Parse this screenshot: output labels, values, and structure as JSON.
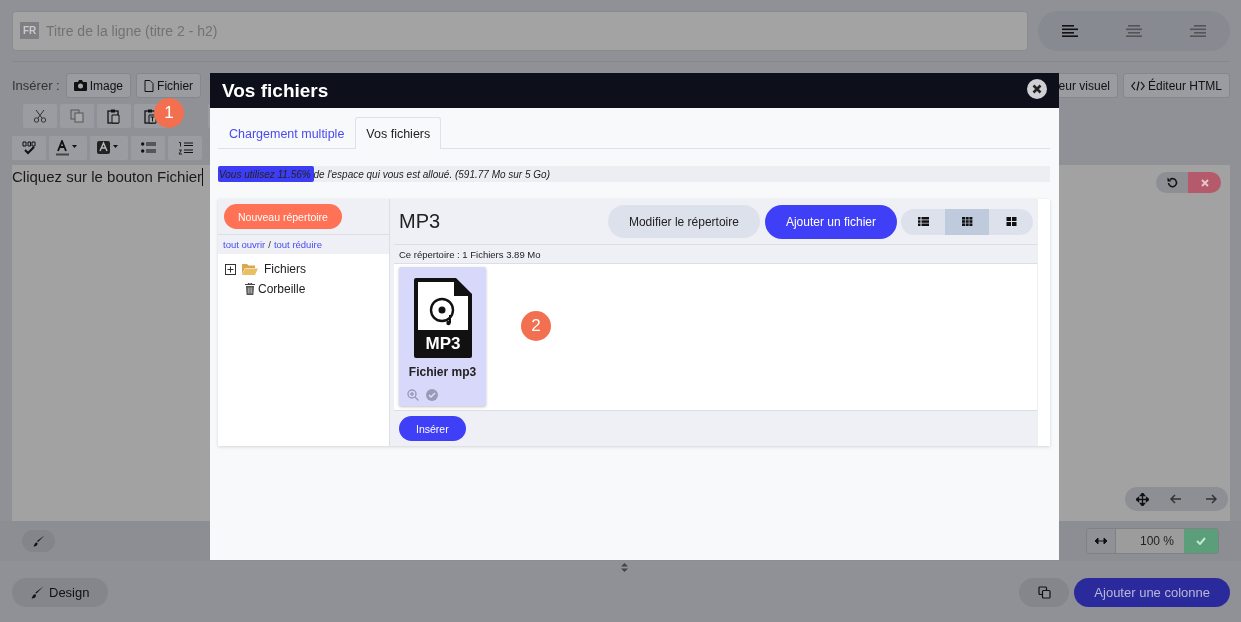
{
  "title_field": {
    "badge": "FR",
    "placeholder": "Titre de la ligne (titre 2 - h2)"
  },
  "align_buttons": [
    {
      "kind": "left",
      "selected": true
    },
    {
      "kind": "center",
      "selected": false
    },
    {
      "kind": "right",
      "selected": false
    }
  ],
  "insert_bar": {
    "label": "Insérer :",
    "buttons": [
      {
        "kind": "image",
        "label": "Image"
      },
      {
        "kind": "file",
        "label": "Fichier"
      }
    ],
    "right_buttons": [
      {
        "kind": "visual",
        "label": "eur visuel"
      },
      {
        "kind": "html",
        "label": "Éditeur HTML"
      }
    ]
  },
  "editor": {
    "text": "Cliquez sur le bouton Fichier"
  },
  "zoom_value": "100 %",
  "design_button": "Design",
  "add_column_button": "Ajouter une colonne",
  "modal": {
    "title": "Vos fichiers",
    "tabs": [
      {
        "label": "Chargement multiple",
        "selected": false
      },
      {
        "label": "Vos fichiers",
        "selected": true
      }
    ],
    "usage": {
      "text": "Vous utilisez 11.56% de l'espace qui vous est alloué. (591.77 Mo sur 5 Go)",
      "level": 0.1156
    },
    "new_folder_button": "Nouveau répertoire",
    "expand_all": "tout ouvrir",
    "separator": "/",
    "collapse_all": "tout réduire",
    "tree": [
      {
        "kind": "folder",
        "label": "Fichiers",
        "expanded": false
      },
      {
        "kind": "trash",
        "label": "Corbeille"
      }
    ],
    "folder_title": "MP3",
    "edit_folder_button": "Modifier le répertoire",
    "add_file_button": "Ajouter un fichier",
    "view_modes": [
      {
        "kind": "list",
        "selected": false
      },
      {
        "kind": "grid",
        "selected": true
      },
      {
        "kind": "large",
        "selected": false
      }
    ],
    "folder_info": "Ce répertoire : 1 Fichiers 3.89 Mo",
    "files": [
      {
        "name": "Fichier mp3",
        "icon_label": "MP3",
        "selected": true
      }
    ],
    "insert_button": "Insérer"
  },
  "steps": [
    {
      "number": "1"
    },
    {
      "number": "2"
    }
  ]
}
